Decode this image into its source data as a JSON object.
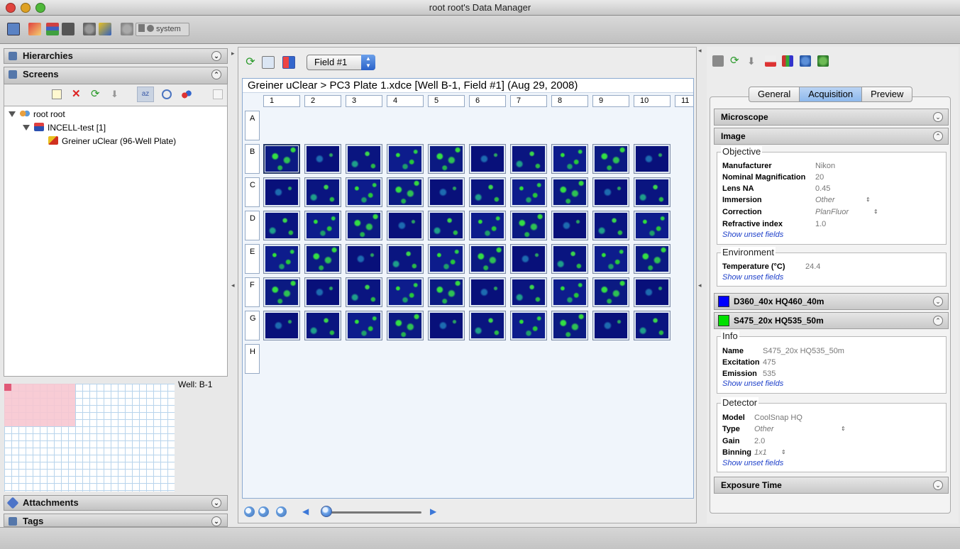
{
  "window": {
    "title": "root root's Data Manager"
  },
  "toolbar": {
    "system_label": "system"
  },
  "left": {
    "hierarchies_label": "Hierarchies",
    "screens_label": "Screens",
    "attachments_label": "Attachments",
    "tags_label": "Tags",
    "tree": [
      {
        "label": "root root"
      },
      {
        "label": "INCELL-test [1]"
      },
      {
        "label": "Greiner uClear (96-Well Plate)"
      }
    ],
    "well_label": "Well: B-1"
  },
  "center": {
    "field_select": "Field #1",
    "plate_title": "Greiner uClear > PC3 Plate 1.xdce [Well B-1, Field #1] (Aug 29, 2008)",
    "columns": [
      "1",
      "2",
      "3",
      "4",
      "5",
      "6",
      "7",
      "8",
      "9",
      "10",
      "11"
    ],
    "rows": [
      "A",
      "B",
      "C",
      "D",
      "E",
      "F",
      "G",
      "H"
    ]
  },
  "right": {
    "tabs": [
      "General",
      "Acquisition",
      "Preview"
    ],
    "active_tab": "Acquisition",
    "microscope_label": "Microscope",
    "image_label": "Image",
    "objective": {
      "title": "Objective",
      "manufacturer_label": "Manufacturer",
      "manufacturer": "Nikon",
      "magnification_label": "Nominal Magnification",
      "magnification": "20",
      "lens_na_label": "Lens NA",
      "lens_na": "0.45",
      "immersion_label": "Immersion",
      "immersion": "Other",
      "correction_label": "Correction",
      "correction": "PlanFluor",
      "refractive_label": "Refractive index",
      "refractive": "1.0",
      "show_unset": "Show unset fields"
    },
    "environment": {
      "title": "Environment",
      "temperature_label": "Temperature (°C)",
      "temperature": "24.4",
      "show_unset": "Show unset fields"
    },
    "channel1": {
      "label": "D360_40x HQ460_40m",
      "color": "#0000ff"
    },
    "channel2": {
      "label": "S475_20x HQ535_50m",
      "color": "#00e000"
    },
    "info": {
      "title": "Info",
      "name_label": "Name",
      "name": "S475_20x HQ535_50m",
      "excitation_label": "Excitation",
      "excitation": "475",
      "emission_label": "Emission",
      "emission": "535",
      "show_unset": "Show unset fields"
    },
    "detector": {
      "title": "Detector",
      "model_label": "Model",
      "model": "CoolSnap HQ",
      "type_label": "Type",
      "type": "Other",
      "gain_label": "Gain",
      "gain": "2.0",
      "binning_label": "Binning",
      "binning": "1x1",
      "show_unset": "Show unset fields"
    },
    "exposure_label": "Exposure Time"
  }
}
